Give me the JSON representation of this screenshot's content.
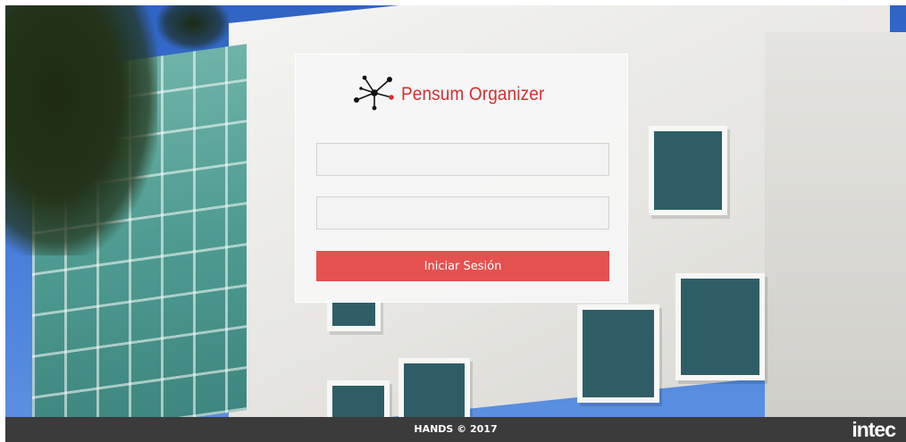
{
  "app": {
    "brand_name": "Pensum Organizer",
    "brand_color": "#d4312f"
  },
  "login": {
    "username_value": "",
    "password_value": "",
    "submit_label": "Iniciar Sesión",
    "submit_color": "#e5514f"
  },
  "footer": {
    "copyright": "HANDS © 2017",
    "partner_logo": "intec"
  },
  "icons": {
    "brand": "network-nodes-icon"
  }
}
